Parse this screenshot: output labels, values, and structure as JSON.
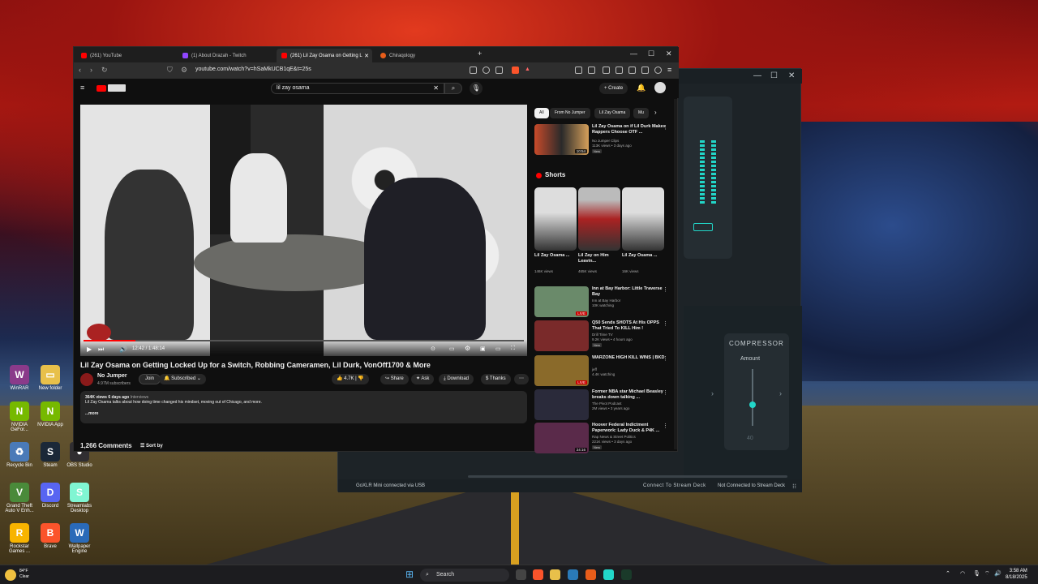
{
  "browser": {
    "tabs": [
      {
        "label": "(261) YouTube",
        "color": "#ff0000"
      },
      {
        "label": "(1) About Drazah - Twitch",
        "color": "#9146ff"
      },
      {
        "label": "(261) Lil Zay Osama on Getting L",
        "color": "#ff0000"
      },
      {
        "label": "Chiraqology",
        "color": "#e85d1a"
      }
    ],
    "url": "youtube.com/watch?v=hSaMkUCB1qE&t=25s"
  },
  "youtube": {
    "search_value": "lil zay osama",
    "create_label": "Create",
    "player": {
      "time": "12:42 / 1:48:14",
      "progress_fraction": 0.117
    },
    "video_title": "Lil Zay Osama on Getting Locked Up for a Switch, Robbing Cameramen, Lil Durk, VonOff1700 & More",
    "channel": {
      "name": "No Jumper",
      "subscribers": "4.97M subscribers",
      "join_label": "Join",
      "subscribed_label": "Subscribed"
    },
    "actions": {
      "likes": "4.7K",
      "share": "Share",
      "ask": "Ask",
      "download": "Download",
      "thanks": "Thanks"
    },
    "description": {
      "views_date": "364K views  6 days ago",
      "tag": "Interviews",
      "text": "Lil Zay Osama talks about how doing time changed his mindset, moving out of Chicago, and more.",
      "more": "...more"
    },
    "comments": {
      "count": "1,266 Comments",
      "sort_label": "Sort by"
    },
    "chips": [
      "All",
      "From No Jumper",
      "Lil Zay Osama",
      "Mu"
    ],
    "first_rec": {
      "title": "Lil Zay Osama on if Lil Durk Makes Rappers Choose OTF ...",
      "channel": "No Jumper Clips",
      "meta": "113K views • 3 days ago",
      "badge": "New",
      "duration": "10:54"
    },
    "shorts_heading": "Shorts",
    "shorts": [
      {
        "title": "Lil Zay Osama ...",
        "views": "146K views"
      },
      {
        "title": "Lil Zay on Him Leavin...",
        "views": "465K views"
      },
      {
        "title": "Lil Zay Osama ...",
        "views": "16K views"
      }
    ],
    "recs": [
      {
        "title": "Inn at Bay Harbor: Little Traverse Bay",
        "channel": "Inn at Bay Harbor",
        "meta": "10K watching",
        "badge": "",
        "overlay": "LIVE",
        "thumb": "#6a8a6a"
      },
      {
        "title": "Q50 Sends SHOTS At His OPPS That Tried To KILL Him !",
        "channel": "Drill Time TV",
        "meta": "9.2K views • 4 hours ago",
        "badge": "New",
        "overlay": "",
        "thumb": "#7a2a2a"
      },
      {
        "title": "WARZONE HIGH KILL WINS | BKD",
        "channel": "jeff",
        "meta": "4.4K watching",
        "badge": "",
        "overlay": "LIVE",
        "thumb": "#8a6a2a"
      },
      {
        "title": "Former NBA star Michael Beasley breaks down talking ...",
        "channel": "The Pivot Podcast",
        "meta": "2M views • 3 years ago",
        "badge": "",
        "overlay": "",
        "thumb": "#2a2a3a"
      },
      {
        "title": "Hoover Federal Indictment Paperwork: Lady Duck & P4K ...",
        "channel": "Rap News & Street Politics",
        "meta": "221K views • 3 days ago",
        "badge": "New",
        "overlay": "24:16",
        "thumb": "#5a2a4a"
      }
    ]
  },
  "goxlr": {
    "compressor_title": "COMPRESSOR",
    "compressor_param": "Amount",
    "compressor_value": "40",
    "status_left": "GoXLR Mini connected via USB",
    "status_mid": "Connect To Stream Deck",
    "status_right": "Not Connected to Stream Deck",
    "accent": "#22d6c8"
  },
  "desktop_icons": [
    {
      "label": "WinRAR",
      "color": "#8a3a8a",
      "glyph": "W"
    },
    {
      "label": "New folder",
      "color": "#e8c04a",
      "glyph": "▭"
    },
    {
      "label": "NVIDIA GeFor...",
      "color": "#76b900",
      "glyph": "N"
    },
    {
      "label": "NVIDIA App",
      "color": "#76b900",
      "glyph": "N"
    },
    {
      "label": "Recycle Bin",
      "color": "#4a7ab8",
      "glyph": "♻"
    },
    {
      "label": "Steam",
      "color": "#1b2838",
      "glyph": "S"
    },
    {
      "label": "OBS Studio",
      "color": "#302e31",
      "glyph": "●"
    },
    {
      "label": "Grand Theft Auto V Enh...",
      "color": "#4a8a3a",
      "glyph": "V"
    },
    {
      "label": "Discord",
      "color": "#5865f2",
      "glyph": "D"
    },
    {
      "label": "Streamlabs Desktop",
      "color": "#80f5d2",
      "glyph": "S"
    },
    {
      "label": "Rockstar Games ...",
      "color": "#f8b400",
      "glyph": "R"
    },
    {
      "label": "Brave",
      "color": "#fb542b",
      "glyph": "B"
    },
    {
      "label": "Wallpaper Engine",
      "color": "#2a6ab8",
      "glyph": "W"
    }
  ],
  "taskbar": {
    "weather_temp": "84°F",
    "weather_desc": "Clear",
    "search_label": "Search",
    "time": "3:58 AM",
    "date": "8/18/2025"
  }
}
